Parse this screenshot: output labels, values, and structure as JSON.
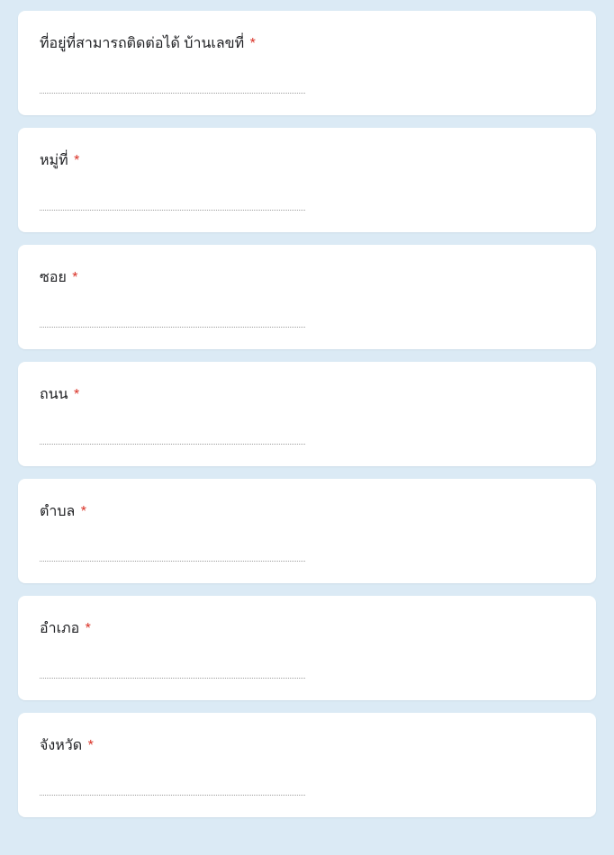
{
  "required_marker": "*",
  "questions": [
    {
      "label": "ที่อยู่ที่สามารถติดต่อได้  บ้านเลขที่",
      "required": true,
      "value": ""
    },
    {
      "label": "หมู่ที่",
      "required": true,
      "value": ""
    },
    {
      "label": "ซอย",
      "required": true,
      "value": ""
    },
    {
      "label": "ถนน",
      "required": true,
      "value": ""
    },
    {
      "label": "ตำบล",
      "required": true,
      "value": ""
    },
    {
      "label": "อำเภอ",
      "required": true,
      "value": ""
    },
    {
      "label": "จังหวัด",
      "required": true,
      "value": ""
    }
  ]
}
